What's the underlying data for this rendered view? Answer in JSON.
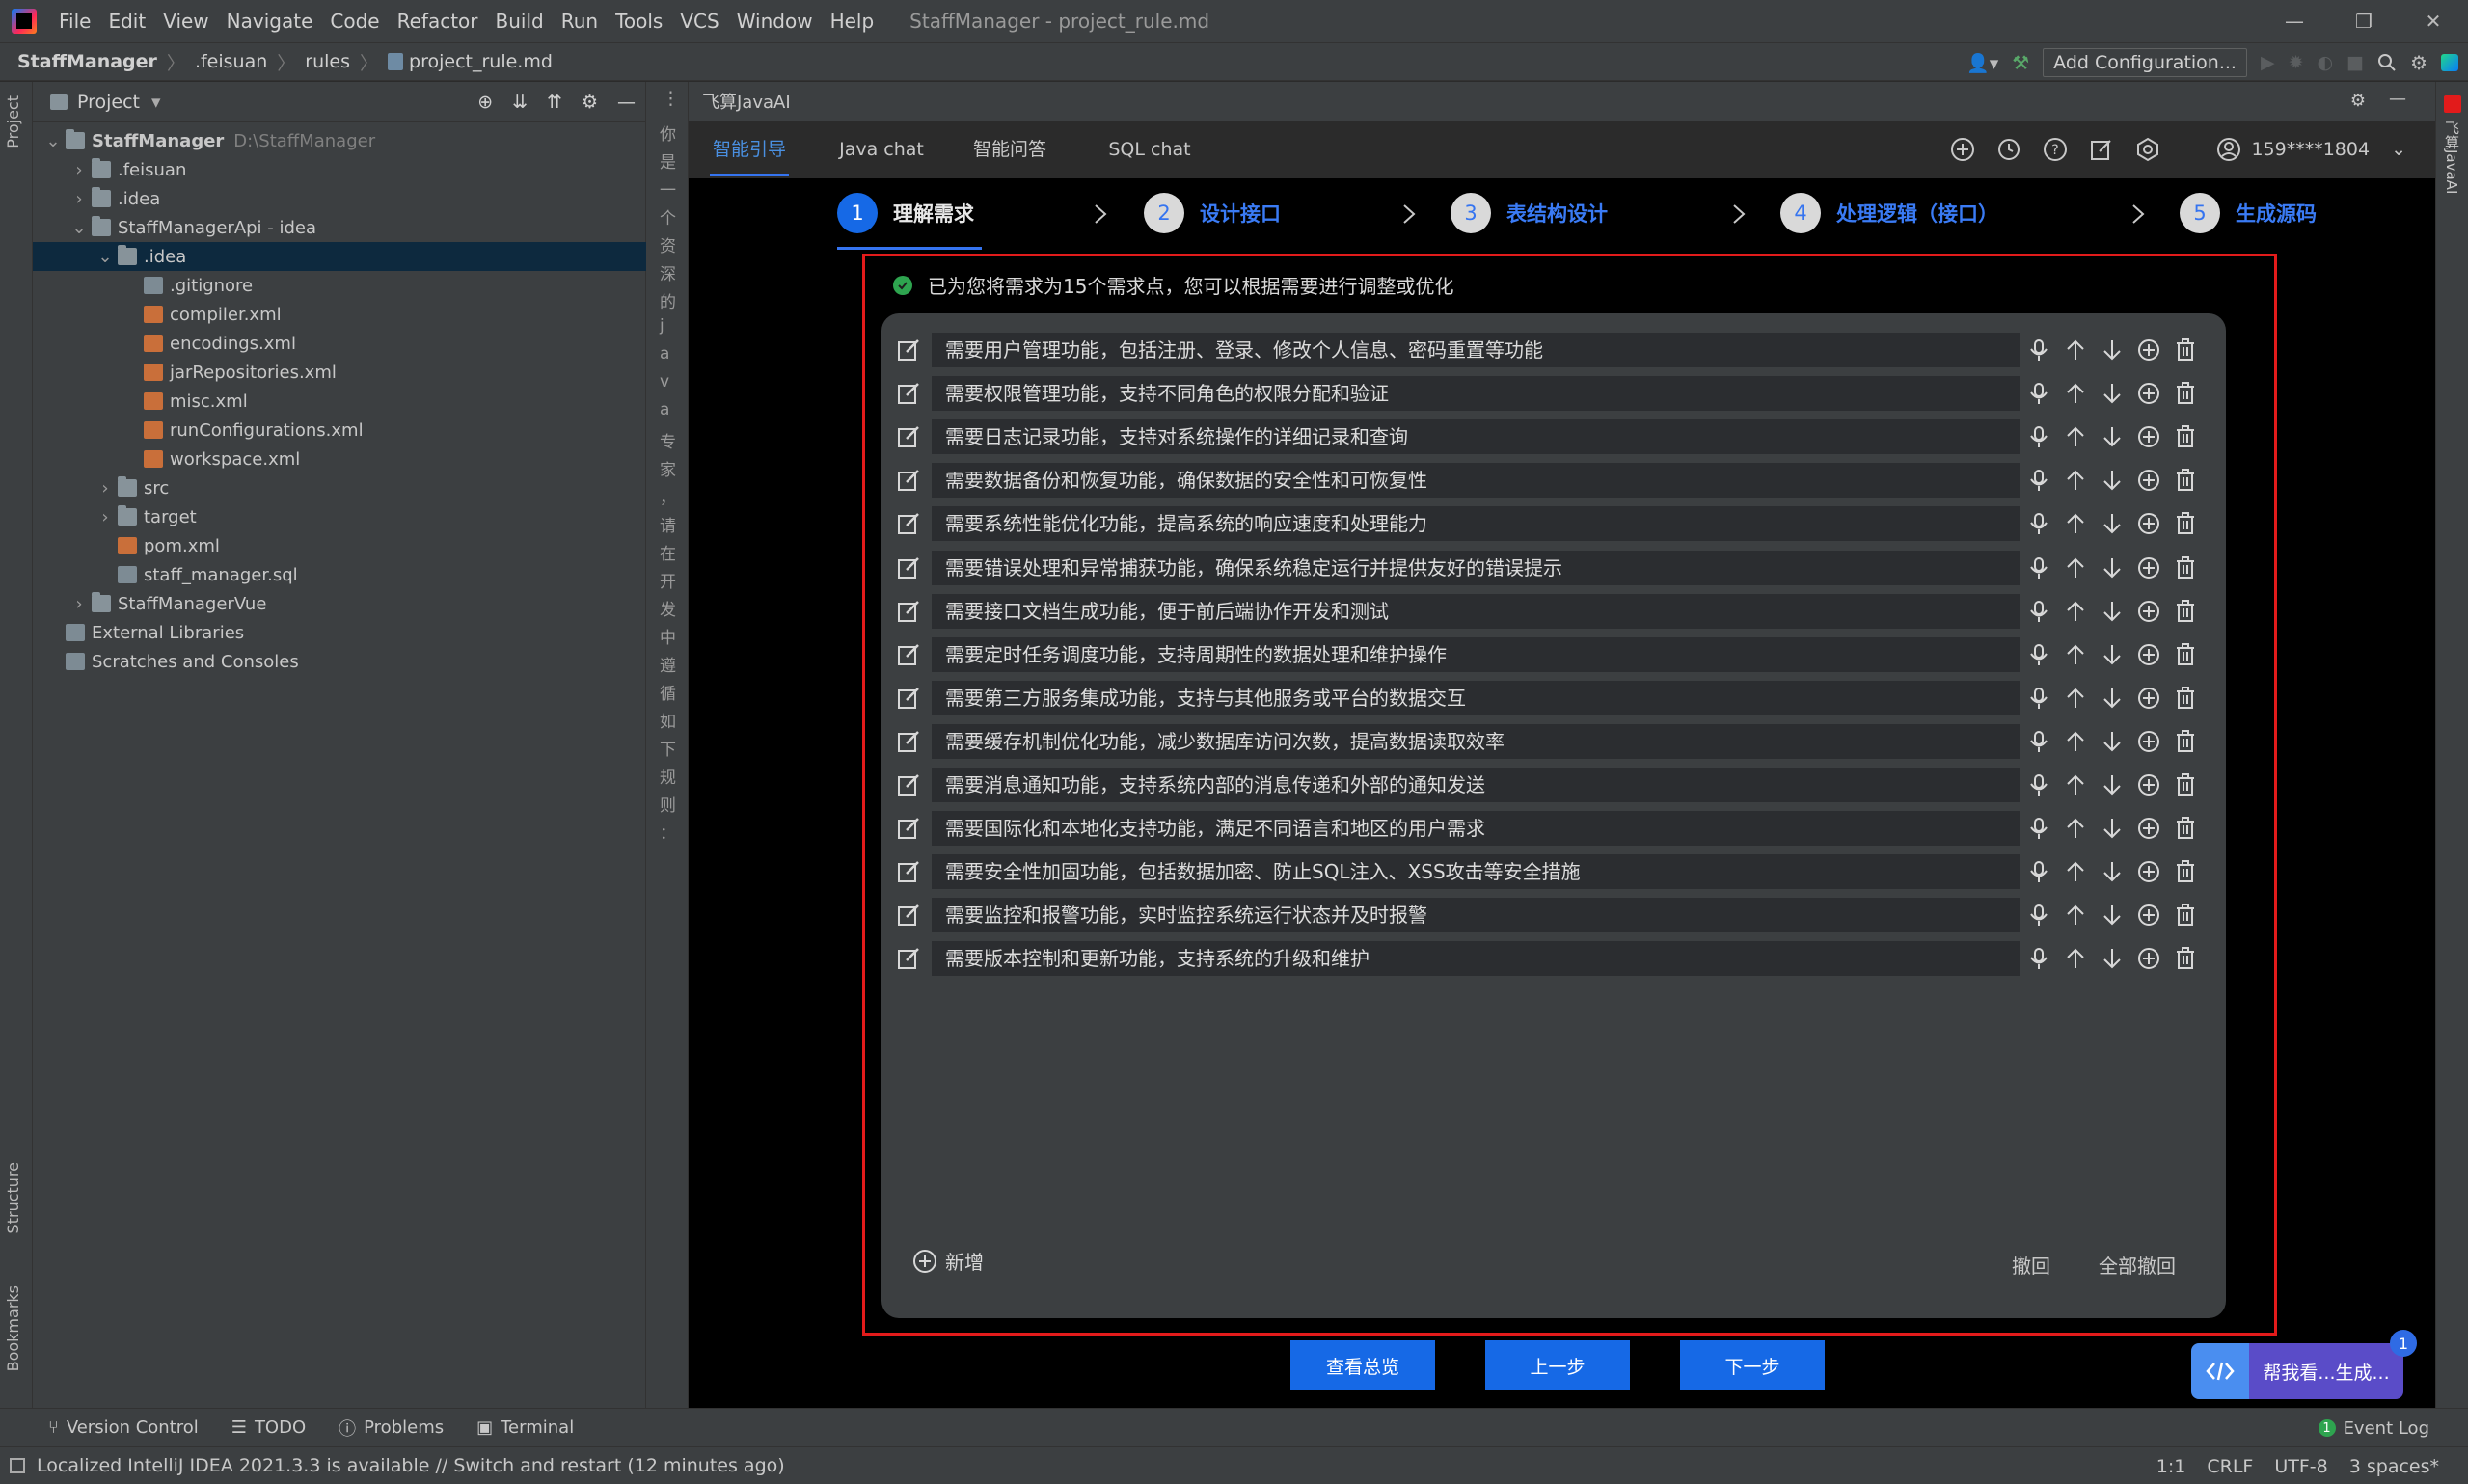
{
  "window": {
    "menu": [
      "File",
      "Edit",
      "View",
      "Navigate",
      "Code",
      "Refactor",
      "Build",
      "Run",
      "Tools",
      "VCS",
      "Window",
      "Help"
    ],
    "title": "StaffManager - project_rule.md"
  },
  "navbar": {
    "crumbs": [
      "StaffManager",
      ".feisuan",
      "rules",
      "project_rule.md"
    ],
    "add_configuration": "Add Configuration..."
  },
  "left_stripe": {
    "project": "Project",
    "structure": "Structure",
    "bookmarks": "Bookmarks"
  },
  "project_panel": {
    "title": "Project",
    "tree": [
      {
        "label": "StaffManager",
        "extra": "D:\\StaffManager",
        "depth": 0,
        "chev": "down",
        "icon": "folder",
        "bold": true
      },
      {
        "label": ".feisuan",
        "depth": 1,
        "chev": "right",
        "icon": "folder"
      },
      {
        "label": ".idea",
        "depth": 1,
        "chev": "right",
        "icon": "folder"
      },
      {
        "label": "StaffManagerApi - idea",
        "depth": 1,
        "chev": "down",
        "icon": "folder"
      },
      {
        "label": ".idea",
        "depth": 2,
        "chev": "down",
        "icon": "folder",
        "selected": true
      },
      {
        "label": ".gitignore",
        "depth": 3,
        "chev": "",
        "icon": "fileg"
      },
      {
        "label": "compiler.xml",
        "depth": 3,
        "chev": "",
        "icon": "filex"
      },
      {
        "label": "encodings.xml",
        "depth": 3,
        "chev": "",
        "icon": "filex"
      },
      {
        "label": "jarRepositories.xml",
        "depth": 3,
        "chev": "",
        "icon": "filex"
      },
      {
        "label": "misc.xml",
        "depth": 3,
        "chev": "",
        "icon": "filex"
      },
      {
        "label": "runConfigurations.xml",
        "depth": 3,
        "chev": "",
        "icon": "filex"
      },
      {
        "label": "workspace.xml",
        "depth": 3,
        "chev": "",
        "icon": "filex"
      },
      {
        "label": "src",
        "depth": 2,
        "chev": "right",
        "icon": "folder"
      },
      {
        "label": "target",
        "depth": 2,
        "chev": "right",
        "icon": "folder"
      },
      {
        "label": "pom.xml",
        "depth": 2,
        "chev": "",
        "icon": "filex"
      },
      {
        "label": "staff_manager.sql",
        "depth": 2,
        "chev": "",
        "icon": "fileg"
      },
      {
        "label": "StaffManagerVue",
        "depth": 1,
        "chev": "right",
        "icon": "folder"
      },
      {
        "label": "External Libraries",
        "depth": 0,
        "chev": "",
        "icon": "fileg"
      },
      {
        "label": "Scratches and Consoles",
        "depth": 0,
        "chev": "",
        "icon": "fileg"
      }
    ]
  },
  "narrow_panel": {
    "chars": [
      "你",
      "是",
      "一",
      "个",
      "资",
      "深",
      "的",
      "j",
      "a",
      "v",
      "a",
      "专",
      "家",
      "，",
      "请",
      "在",
      "开",
      "发",
      "中",
      "遵",
      "循",
      "如",
      "下",
      "规",
      "则",
      "："
    ]
  },
  "ai_panel": {
    "title": "飞算JavaAI",
    "tabs": [
      "智能引导",
      "Java chat",
      "智能问答",
      "SQL chat"
    ],
    "account": "159****1804",
    "steps": [
      {
        "num": "1",
        "label": "理解需求"
      },
      {
        "num": "2",
        "label": "设计接口"
      },
      {
        "num": "3",
        "label": "表结构设计"
      },
      {
        "num": "4",
        "label": "处理逻辑（接口）"
      },
      {
        "num": "5",
        "label": "生成源码"
      }
    ],
    "notice": "已为您将需求为15个需求点，您可以根据需要进行调整或优化",
    "requirements": [
      "需要用户管理功能，包括注册、登录、修改个人信息、密码重置等功能",
      "需要权限管理功能，支持不同角色的权限分配和验证",
      "需要日志记录功能，支持对系统操作的详细记录和查询",
      "需要数据备份和恢复功能，确保数据的安全性和可恢复性",
      "需要系统性能优化功能，提高系统的响应速度和处理能力",
      "需要错误处理和异常捕获功能，确保系统稳定运行并提供友好的错误提示",
      "需要接口文档生成功能，便于前后端协作开发和测试",
      "需要定时任务调度功能，支持周期性的数据处理和维护操作",
      "需要第三方服务集成功能，支持与其他服务或平台的数据交互",
      "需要缓存机制优化功能，减少数据库访问次数，提高数据读取效率",
      "需要消息通知功能，支持系统内部的消息传递和外部的通知发送",
      "需要国际化和本地化支持功能，满足不同语言和地区的用户需求",
      "需要安全性加固功能，包括数据加密、防止SQL注入、XSS攻击等安全措施",
      "需要监控和报警功能，实时监控系统运行状态并及时报警",
      "需要版本控制和更新功能，支持系统的升级和维护"
    ],
    "add_new": "新增",
    "undo": "撤回",
    "undo_all": "全部撤回",
    "buttons": {
      "overview": "查看总览",
      "prev": "上一步",
      "next": "下一步"
    },
    "helper": {
      "label": "帮我看...生成...",
      "badge": "1"
    },
    "right_label": "飞算JavaAI"
  },
  "toolwindows": {
    "version_control": "Version Control",
    "todo": "TODO",
    "problems": "Problems",
    "terminal": "Terminal",
    "event_log": "Event Log"
  },
  "status": {
    "message": "Localized IntelliJ IDEA 2021.3.3 is available // Switch and restart (12 minutes ago)",
    "position": "1:1",
    "line_sep": "CRLF",
    "encoding": "UTF-8",
    "indent": "3 spaces*"
  },
  "colors": {
    "accent": "#3574f0",
    "highlight_border": "#e21b1b",
    "ok": "#2ea44f"
  }
}
